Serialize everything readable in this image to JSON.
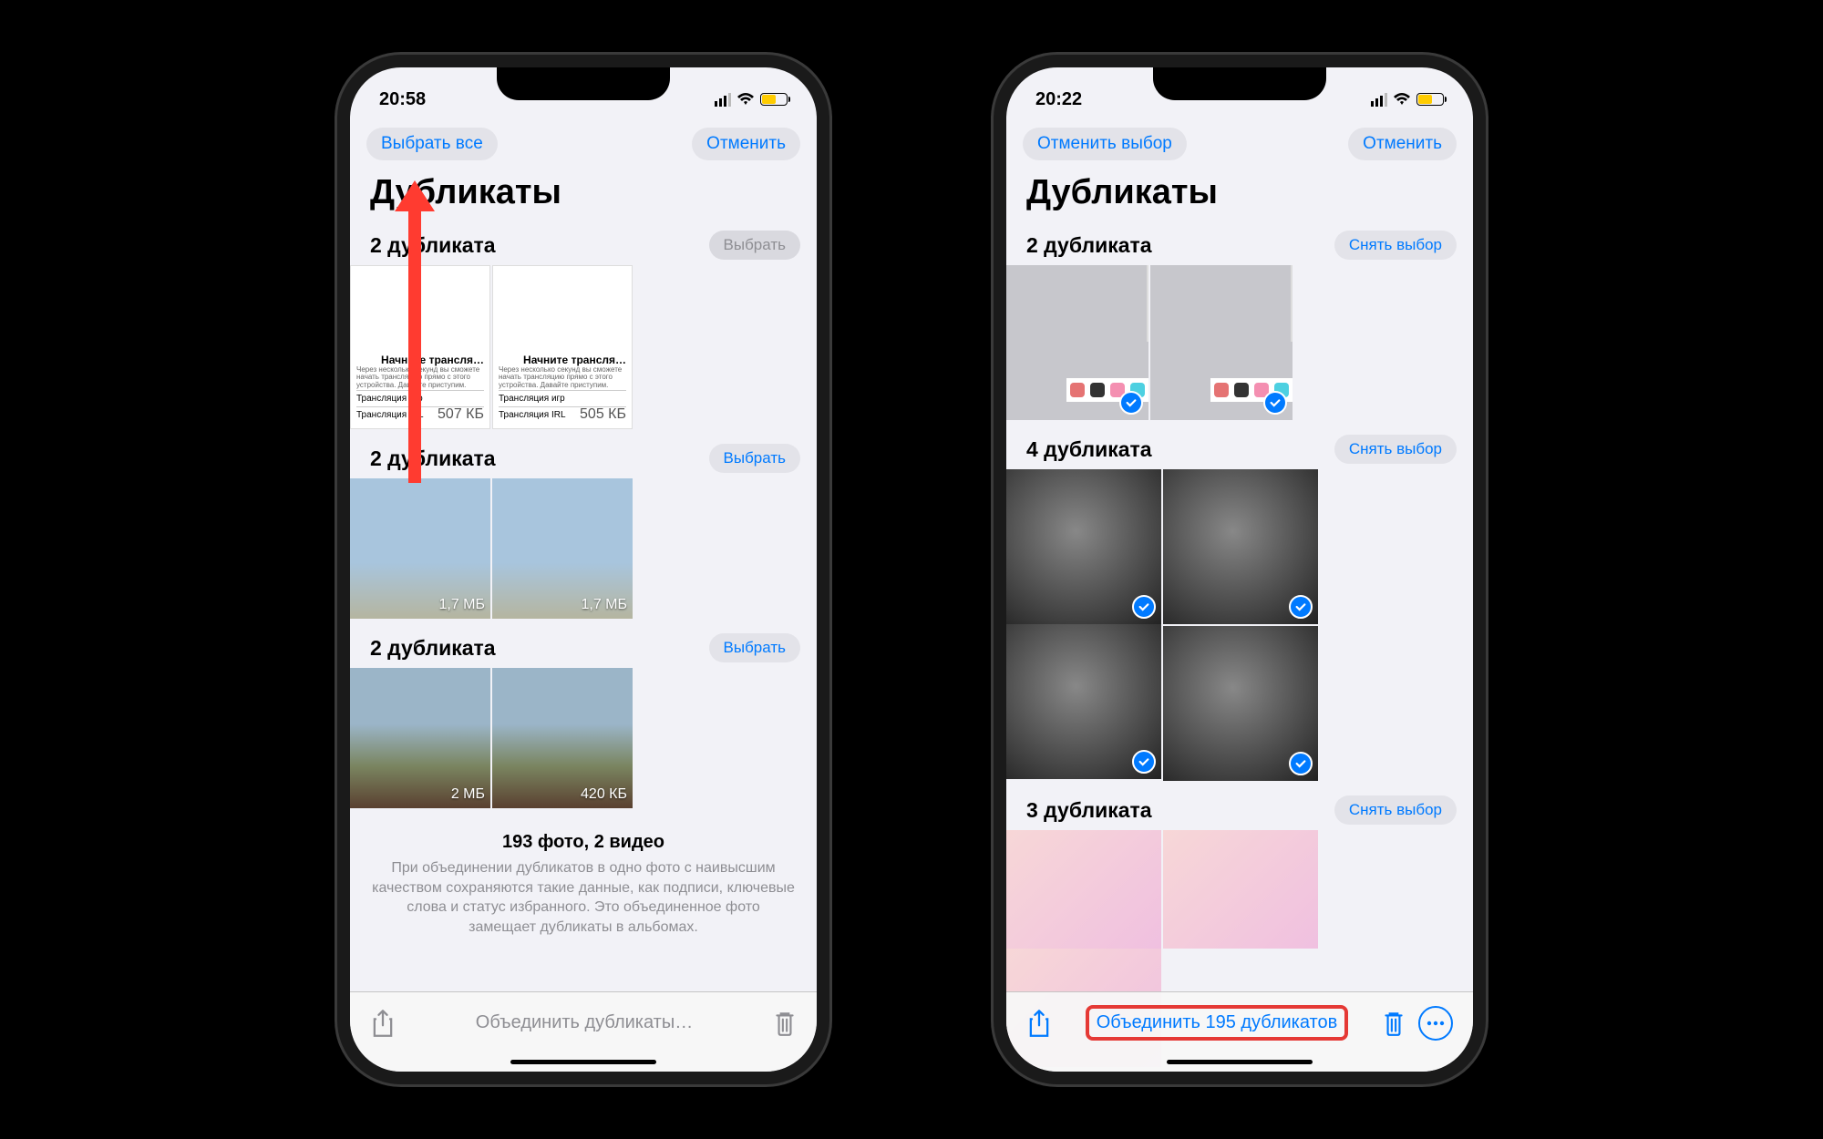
{
  "phone1": {
    "status_time": "20:58",
    "top_left_btn": "Выбрать все",
    "top_right_btn": "Отменить",
    "page_title": "Дубликаты",
    "groups": [
      {
        "title": "2 дубликата",
        "button": "Выбрать",
        "button_muted": true,
        "thumbs": [
          {
            "line1": "Начните трансля…",
            "desc": "Через несколько секунд вы сможете начать трансляцию прямо с этого устройства. Давайте приступим.",
            "row1": "Трансляция игр",
            "row2": "Трансляция IRL",
            "size": "507 КБ"
          },
          {
            "line1": "Начните трансля…",
            "desc": "Через несколько секунд вы сможете начать трансляцию прямо с этого устройства. Давайте приступим.",
            "row1": "Трансляция игр",
            "row2": "Трансляция IRL",
            "size": "505 КБ"
          }
        ]
      },
      {
        "title": "2 дубликата",
        "button": "Выбрать",
        "thumbs": [
          {
            "size": "1,7 МБ"
          },
          {
            "size": "1,7 МБ"
          }
        ]
      },
      {
        "title": "2 дубликата",
        "button": "Выбрать",
        "thumbs": [
          {
            "size": "2 МБ"
          },
          {
            "size": "420 КБ"
          }
        ]
      }
    ],
    "summary_title": "193 фото, 2 видео",
    "summary_desc": "При объединении дубликатов в одно фото с наивысшим качеством сохраняются такие данные, как подписи, ключевые слова и статус избранного. Это объединенное фото замещает дубликаты в альбомах.",
    "toolbar_center": "Объединить дубликаты…"
  },
  "phone2": {
    "status_time": "20:22",
    "top_left_btn": "Отменить выбор",
    "top_right_btn": "Отменить",
    "page_title": "Дубликаты",
    "groups": [
      {
        "title": "2 дубликата",
        "button": "Снять выбор",
        "thumbs": [
          {},
          {}
        ]
      },
      {
        "title": "4 дубликата",
        "button": "Снять выбор",
        "thumbs": [
          {},
          {},
          {},
          {}
        ]
      },
      {
        "title": "3 дубликата",
        "button": "Снять выбор",
        "thumbs": [
          {},
          {},
          {}
        ]
      }
    ],
    "toolbar_center": "Объединить 195 дубликатов"
  }
}
